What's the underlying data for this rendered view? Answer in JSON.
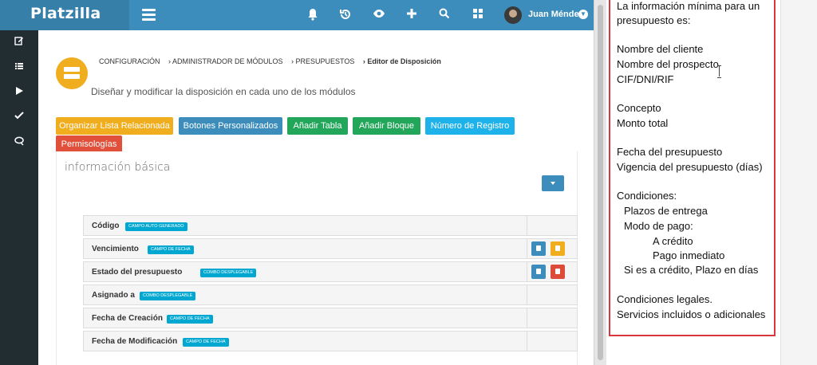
{
  "app": {
    "logo": "Platzilla",
    "user_name": "Juan Méndez",
    "top_icons": [
      "bell-icon",
      "history-icon",
      "eye-icon",
      "plus-icon",
      "search-icon",
      "grid-icon"
    ],
    "side_icons": [
      "edit-icon",
      "list-icon",
      "play-icon",
      "check-icon",
      "chat-icon"
    ]
  },
  "breadcrumb": {
    "items": [
      "CONFIGURACIÓN",
      "› ADMINISTRADOR DE MÓDULOS",
      "› PRESUPUESTOS",
      "› Editor de Disposición"
    ]
  },
  "page": {
    "subtitle": "Diseñar y modificar la disposición en cada uno de los módulos"
  },
  "toolbar": {
    "buttons": [
      {
        "label": "Organizar Lista Relacionada",
        "color": "#f0ad1e"
      },
      {
        "label": "Botones Personalizados",
        "color": "#3c8dbc"
      },
      {
        "label": "Añadir Tabla",
        "color": "#21a65a"
      },
      {
        "label": "Añadir Bloque",
        "color": "#21a65a"
      },
      {
        "label": "Número de Registro",
        "color": "#1fb2ea"
      },
      {
        "label": "Permisologías",
        "color": "#e0503a"
      }
    ]
  },
  "panel": {
    "title": "información básica",
    "fields": [
      {
        "label": "Código",
        "badge": "CAMPO AUTO GENERADO"
      },
      {
        "label": "Vencimiento",
        "badge": "CAMPO DE FECHA"
      },
      {
        "label": "Estado del presupuesto",
        "badge": "COMBO DESPLEGABLE"
      },
      {
        "label": "Asignado a",
        "badge": "COMBO DESPLEGABLE"
      },
      {
        "label": "Fecha de Creación",
        "badge": "CAMPO DE FECHA"
      },
      {
        "label": "Fecha de Modificación",
        "badge": "CAMPO DE FECHA"
      }
    ]
  },
  "notes": {
    "lines": [
      "La información mínima para un",
      "presupuesto es:",
      "Nombre del cliente",
      "Nombre del prospecto",
      "CIF/DNI/RIF",
      "Concepto",
      "Monto total",
      "Fecha del presupuesto",
      "Vigencia del presupuesto (días)",
      "Condiciones:",
      "Plazos de entrega",
      "Modo de pago:",
      "A crédito",
      "Pago inmediato",
      "Si es a crédito, Plazo en días",
      "Condiciones legales.",
      "Servicios incluidos o adicionales"
    ]
  },
  "colors": {
    "header": "#3c8dbc",
    "sidebar": "#222d32",
    "badge": "#00a7d0",
    "notes_border": "#d9363e"
  }
}
